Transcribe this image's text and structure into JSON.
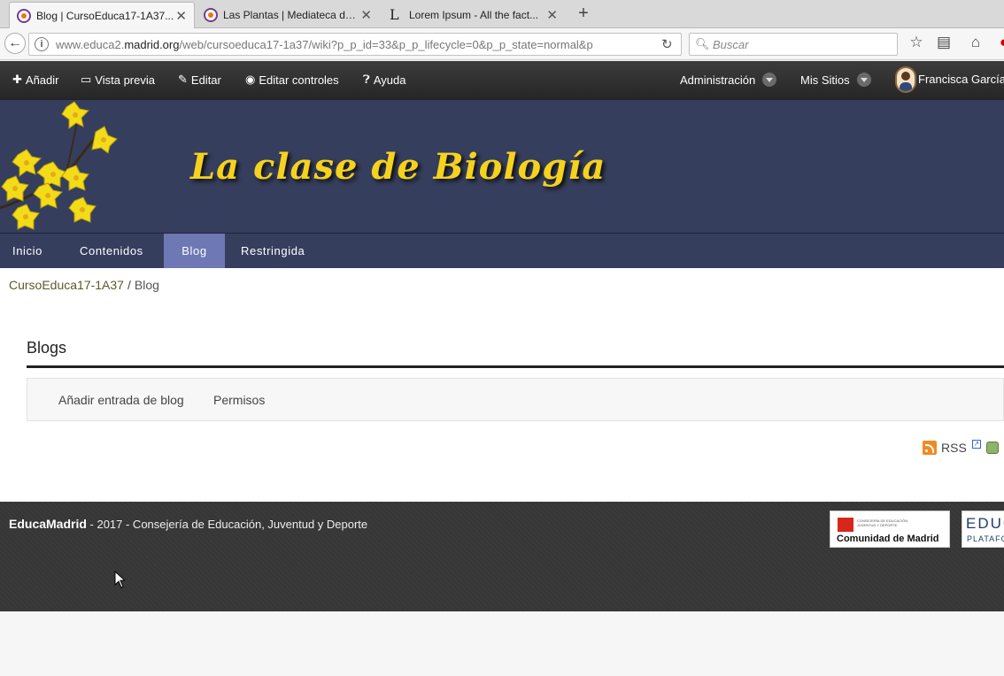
{
  "browser": {
    "tabs": [
      {
        "title": "Blog | CursoEduca17-1A37...",
        "active": true
      },
      {
        "title": "Las Plantas | Mediateca de...",
        "active": false
      },
      {
        "title": "Lorem Ipsum - All the fact...",
        "active": false
      }
    ],
    "new_tab_label": "+",
    "url": {
      "pre": "www.educa2.",
      "domain": "madrid.org",
      "post": "/web/cursoeduca17-1a37/wiki?p_p_id=33&p_p_lifecycle=0&p_p_state=normal&p"
    },
    "search_placeholder": "Buscar"
  },
  "dockbar": {
    "add": "Añadir",
    "preview": "Vista previa",
    "edit": "Editar",
    "edit_controls": "Editar controles",
    "help": "Ayuda",
    "admin": "Administración",
    "my_sites": "Mis Sitios",
    "user": "Francisca García"
  },
  "banner": {
    "title": "La clase de Biología"
  },
  "site_nav": {
    "items": [
      "Inicio",
      "Contenidos",
      "Blog",
      "Restringida"
    ],
    "selected": "Blog"
  },
  "breadcrumb": {
    "items": [
      "CursoEduca17-1A37",
      "Blog"
    ],
    "separator": "/"
  },
  "portlet": {
    "title": "Blogs",
    "actions": [
      "Añadir entrada de blog",
      "Permisos"
    ],
    "rss_label": "RSS"
  },
  "footer": {
    "brand": "EducaMadrid",
    "text": " - 2017 - Consejería de Educación, Juventud y Deporte",
    "cam_small_1": "CONSEJERÍA DE EDUCACIÓN",
    "cam_small_2": "JUVENTUD Y DEPORTE",
    "cam_name": "Comunidad de Madrid",
    "educa_big": "EDUCA",
    "educa_small": "PLATAFORMA"
  },
  "colors": {
    "banner_bg": "#363e5e",
    "nav_selected": "#6e78b4",
    "title_yellow": "#f5d21e",
    "dockbar_bg": "#2f2f2f"
  }
}
